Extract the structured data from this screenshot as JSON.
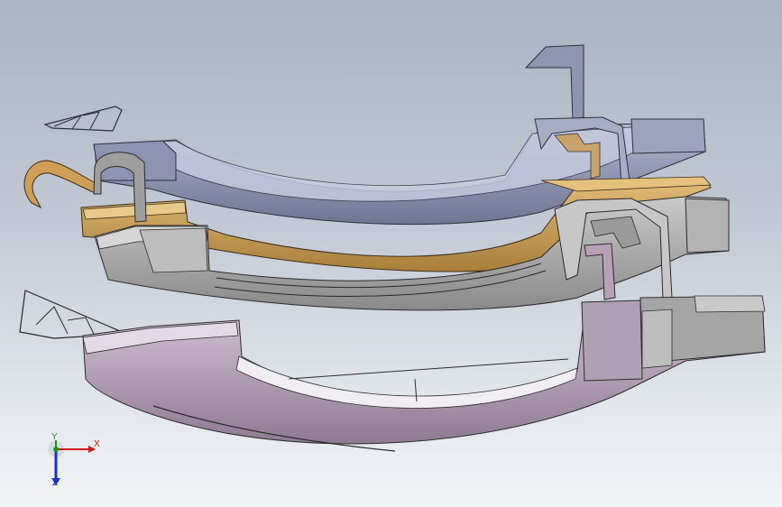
{
  "viewport": {
    "background_top": "#a9b3c2",
    "background_bottom": "#f1f3f6"
  },
  "parts": [
    {
      "name": "upper-handle-part",
      "color": "#8c93b0"
    },
    {
      "name": "orange-bracket-part",
      "color": "#cfa35a"
    },
    {
      "name": "middle-housing-part",
      "color": "#a9a9a9"
    },
    {
      "name": "lower-handle-part",
      "color": "#bba6bd"
    }
  ],
  "triad": {
    "x_label": "X",
    "y_label": "Y",
    "z_label": "Z",
    "x_color": "#d01818",
    "y_color": "#1a9a1a",
    "z_color": "#1a2ed0"
  }
}
